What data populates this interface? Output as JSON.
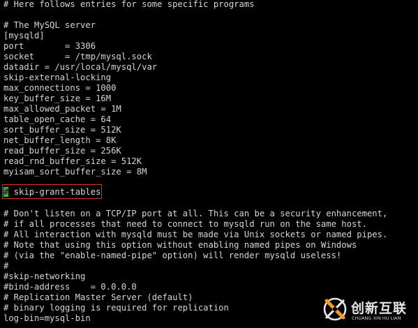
{
  "terminal": {
    "lines": [
      "# Here follows entries for some specific programs",
      "",
      "# The MySQL server",
      "[mysqld]",
      "port        = 3306",
      "socket      = /tmp/mysql.sock",
      "datadir = /usr/local/mysql/var",
      "skip-external-locking",
      "max_connections = 1000",
      "key_buffer_size = 16M",
      "max_allowed_packet = 1M",
      "table_open_cache = 64",
      "sort_buffer_size = 512K",
      "net_buffer_length = 8K",
      "read_buffer_size = 256K",
      "read_rnd_buffer_size = 512K",
      "myisam_sort_buffer_size = 8M",
      "",
      "",
      "",
      "# Don't listen on a TCP/IP port at all. This can be a security enhancement,",
      "# if all processes that need to connect to mysqld run on the same host.",
      "# All interaction with mysqld must be made via Unix sockets or named pipes.",
      "# Note that using this option without enabling named pipes on Windows",
      "# (via the \"enable-named-pipe\" option) will render mysqld useless!",
      "#",
      "#skip-networking",
      "#bind-address    = 0.0.0.0",
      "# Replication Master Server (default)",
      "# binary logging is required for replication",
      "log-bin=mysql-bin"
    ],
    "cursor_line": {
      "cursor_char": "#",
      "rest": " skip-grant-tables"
    }
  },
  "watermark": {
    "cn": "创新互联",
    "en": "CHUANG XIN HU LIAN"
  },
  "colors": {
    "background": "#000000",
    "text": "#d6d6d6",
    "cursor": "#1fd01f",
    "highlight_border": "#e0302c"
  }
}
